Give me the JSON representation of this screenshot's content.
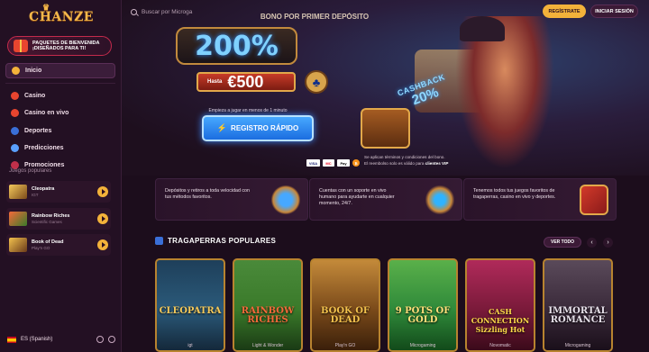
{
  "brand": {
    "logo_text": "CHANZE"
  },
  "sidebar": {
    "promo_line1": "PAQUETES DE BIENVENIDA",
    "promo_line2": "¡DISEÑADOS PARA TI!",
    "nav": [
      {
        "label": "Inicio",
        "icon": "home-icon",
        "color": "#f3b23a"
      },
      {
        "label": "Casino",
        "icon": "heart-icon",
        "color": "#e8452f"
      },
      {
        "label": "Casino en vivo",
        "icon": "live-dealer-icon",
        "color": "#e8452f"
      },
      {
        "label": "Deportes",
        "icon": "ball-icon",
        "color": "#3a6fd8"
      },
      {
        "label": "Predicciones",
        "icon": "rocket-icon",
        "color": "#5aa0ff"
      },
      {
        "label": "Promociones",
        "icon": "star-icon",
        "color": "#c0304a"
      }
    ],
    "popular_title": "Juegos populares",
    "popular_games": [
      {
        "name": "Cleopatra",
        "provider": "IGT"
      },
      {
        "name": "Rainbow Riches",
        "provider": "Scientific Games"
      },
      {
        "name": "Book of Dead",
        "provider": "Play'n GO"
      }
    ],
    "language": "ES (Spanish)"
  },
  "topbar": {
    "search_placeholder": "Buscar por Microga",
    "register_label": "REGÍSTRATE",
    "login_label": "INICIAR SESIÓN"
  },
  "hero": {
    "bonus_title": "BONO POR PRIMER DEPÓSITO",
    "percent": "200%",
    "upto_label": "Hasta",
    "amount": "€500",
    "hint": "Empieza a jugar en menos de 1 minuto",
    "quick_register_label": "REGISTRO RÁPIDO",
    "cashback_line1": "CASHBACK",
    "cashback_line2": "20%",
    "payments": [
      "VISA",
      "MC",
      "Pay",
      "₿"
    ],
    "terms_line1": "Se aplican términos y condiciones del bono.",
    "terms_line2": "El reembolso solo es válido para",
    "terms_vip": "clientes VIP"
  },
  "features": [
    {
      "text": "Depósitos y retiros a toda velocidad con tus métodos favoritos."
    },
    {
      "text": "Cuentas con un soporte en vivo humano para ayudarte en cualquier momento, 24/7."
    },
    {
      "text": "Tenemos todos tus juegos favoritos de tragaperras, casino en vivo y deportes."
    }
  ],
  "slots": {
    "title": "TRAGAPERRAS POPULARES",
    "see_all_label": "VER TODO",
    "cards": [
      {
        "title": "CLEOPATRA",
        "provider": "igt",
        "bg": "#2b5a7a",
        "title_color": "#f4c95b"
      },
      {
        "title": "RAINBOW RICHES",
        "provider": "Light & Wonder",
        "bg": "#3a7a2a",
        "title_color": "#f46a3a"
      },
      {
        "title": "BOOK OF DEAD",
        "provider": "Play'n GO",
        "bg": "#7a4a1a",
        "title_color": "#f2c14d"
      },
      {
        "title": "9 POTS OF GOLD",
        "provider": "Microgaming",
        "bg": "#2f8a3a",
        "title_color": "#ffe07a"
      },
      {
        "title": "CASH CONNECTION Sizzling Hot",
        "provider": "Novomatic",
        "bg": "#7a1a3a",
        "title_color": "#ffdb4a"
      },
      {
        "title": "IMMORTAL ROMANCE",
        "provider": "Microgaming",
        "bg": "#3a2a3a",
        "title_color": "#e7e1ea"
      }
    ]
  }
}
